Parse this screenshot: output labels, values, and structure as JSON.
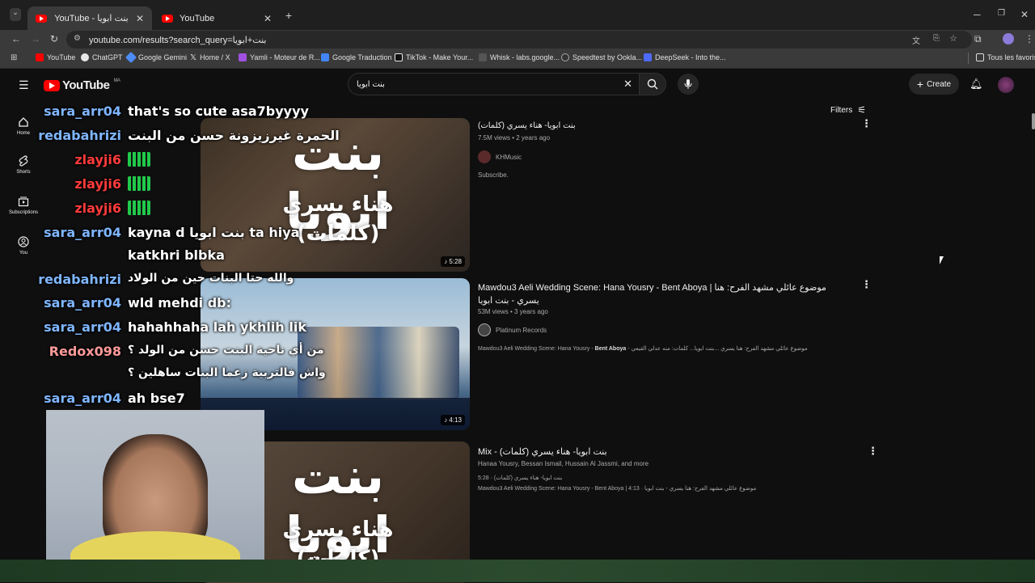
{
  "browser": {
    "tabs": [
      {
        "title": "YouTube - بنت ابويا",
        "active": true
      },
      {
        "title": "YouTube",
        "active": false
      }
    ],
    "url": "youtube.com/results?search_query=بنت+ابويا",
    "bookmarks": [
      {
        "label": "YouTube",
        "color": "#ff0000"
      },
      {
        "label": "ChatGPT",
        "color": "#e8e8e8"
      },
      {
        "label": "Google Gemini",
        "color": "#4e8cf5"
      },
      {
        "label": "Home / X",
        "color": "#e8e8e8"
      },
      {
        "label": "Yamli - Moteur de R...",
        "color": "#a050e0"
      },
      {
        "label": "Google Traduction",
        "color": "#4285f4"
      },
      {
        "label": "TikTok - Make Your...",
        "color": "#e8e8e8"
      },
      {
        "label": "Whisk - labs.google...",
        "color": "#555555"
      },
      {
        "label": "Speedtest by Ookla...",
        "color": "#333333"
      },
      {
        "label": "DeepSeek - Into the...",
        "color": "#4d6bfe"
      }
    ],
    "all_bookmarks": "Tous les favoris"
  },
  "youtube": {
    "logo_text": "YouTube",
    "region": "MA",
    "search_value": "بنت ابويا",
    "create_label": "Create",
    "filters_label": "Filters",
    "sidebar": [
      {
        "label": "Home",
        "icon": "home-icon"
      },
      {
        "label": "Shorts",
        "icon": "shorts-icon"
      },
      {
        "label": "Subscriptions",
        "icon": "subscriptions-icon"
      },
      {
        "label": "You",
        "icon": "you-icon"
      }
    ],
    "results": [
      {
        "title": "بنت ابويا- هناء يسري (كلمات)",
        "meta": "7.5M views • 2 years ago",
        "channel": "KHMusic",
        "description": "Subscribe.",
        "duration": "5:28",
        "thumb_text_1": "بنت ابويا",
        "thumb_text_2": "هناء يسري",
        "thumb_text_3": "(كلمات)"
      },
      {
        "title_line1": "Mawdou3 Aeli Wedding Scene: Hana Yousry - Bent Aboya | موضوع عائلي مشهد الفرح: هنا",
        "title_line2": "يسري - بنت ابويا",
        "meta": "53M views • 3 years ago",
        "channel": "Platinum Records",
        "description_plain": "Mawdou3 Aeli Wedding Scene: Hana Yousry - ",
        "description_bold": "Bent Aboya",
        "description_rest": " - موضوع عائلي مشهد الفرح: هنا يسري ...بنت ابويا... كلمات: منه عدلي القيعي",
        "duration": "4:13"
      },
      {
        "title": "Mix - بنت ابويا- هناء يسري (كلمات)",
        "meta": "Hanaa Yousry, Bessan Ismail, Hussain Al Jassmi, and more",
        "line1": "5:28 · بنت ابويا- هناء يسري (كلمات)",
        "line2": "Mawdou3 Aeli Wedding Scene: Hana Yousry - Bent Aboya | 4:13 · موضوع عائلي مشهد الفرح: هنا يسري - بنت ابويا",
        "thumb_text_1": "بنت ابويا",
        "thumb_text_2": "هناء يسري",
        "thumb_text_3": "(كلمات)"
      }
    ]
  },
  "chat": [
    {
      "user": "sara_arr04",
      "color": "#7fb6ff",
      "msg": "that's so cute asa7byyyy"
    },
    {
      "user": "redabahrizi",
      "color": "#7fb6ff",
      "msg": "الحمرة غيرزيزونة حسن من البنت"
    },
    {
      "user": "zlayji6",
      "color": "#ff3b3b",
      "msg": ""
    },
    {
      "user": "zlayji6",
      "color": "#ff3b3b",
      "msg": ""
    },
    {
      "user": "zlayji6",
      "color": "#ff3b3b",
      "msg": ""
    },
    {
      "user": "sara_arr04",
      "color": "#7fb6ff",
      "msg": "kayna d بنت ابويا ta hiya"
    },
    {
      "user": "",
      "color": "#7fb6ff",
      "msg": "katkhri blbka"
    },
    {
      "user": "redabahrizi",
      "color": "#7fb6ff",
      "msg": "والله حتا البنات حين من الولاد"
    },
    {
      "user": "sara_arr04",
      "color": "#7fb6ff",
      "msg": "wld mehdi db:"
    },
    {
      "user": "sara_arr04",
      "color": "#7fb6ff",
      "msg": "hahahhaha lah ykhlih lik"
    },
    {
      "user": "Redox098",
      "color": "#ff9a9a",
      "msg": "من أي ناحية البنت حسن من الولد ؟"
    },
    {
      "user": "",
      "color": "#ff9a9a",
      "msg": "واش فالتربية زعما البنات ساهلين ؟"
    },
    {
      "user": "sara_arr04",
      "color": "#7fb6ff",
      "msg": "ah bse7"
    }
  ]
}
